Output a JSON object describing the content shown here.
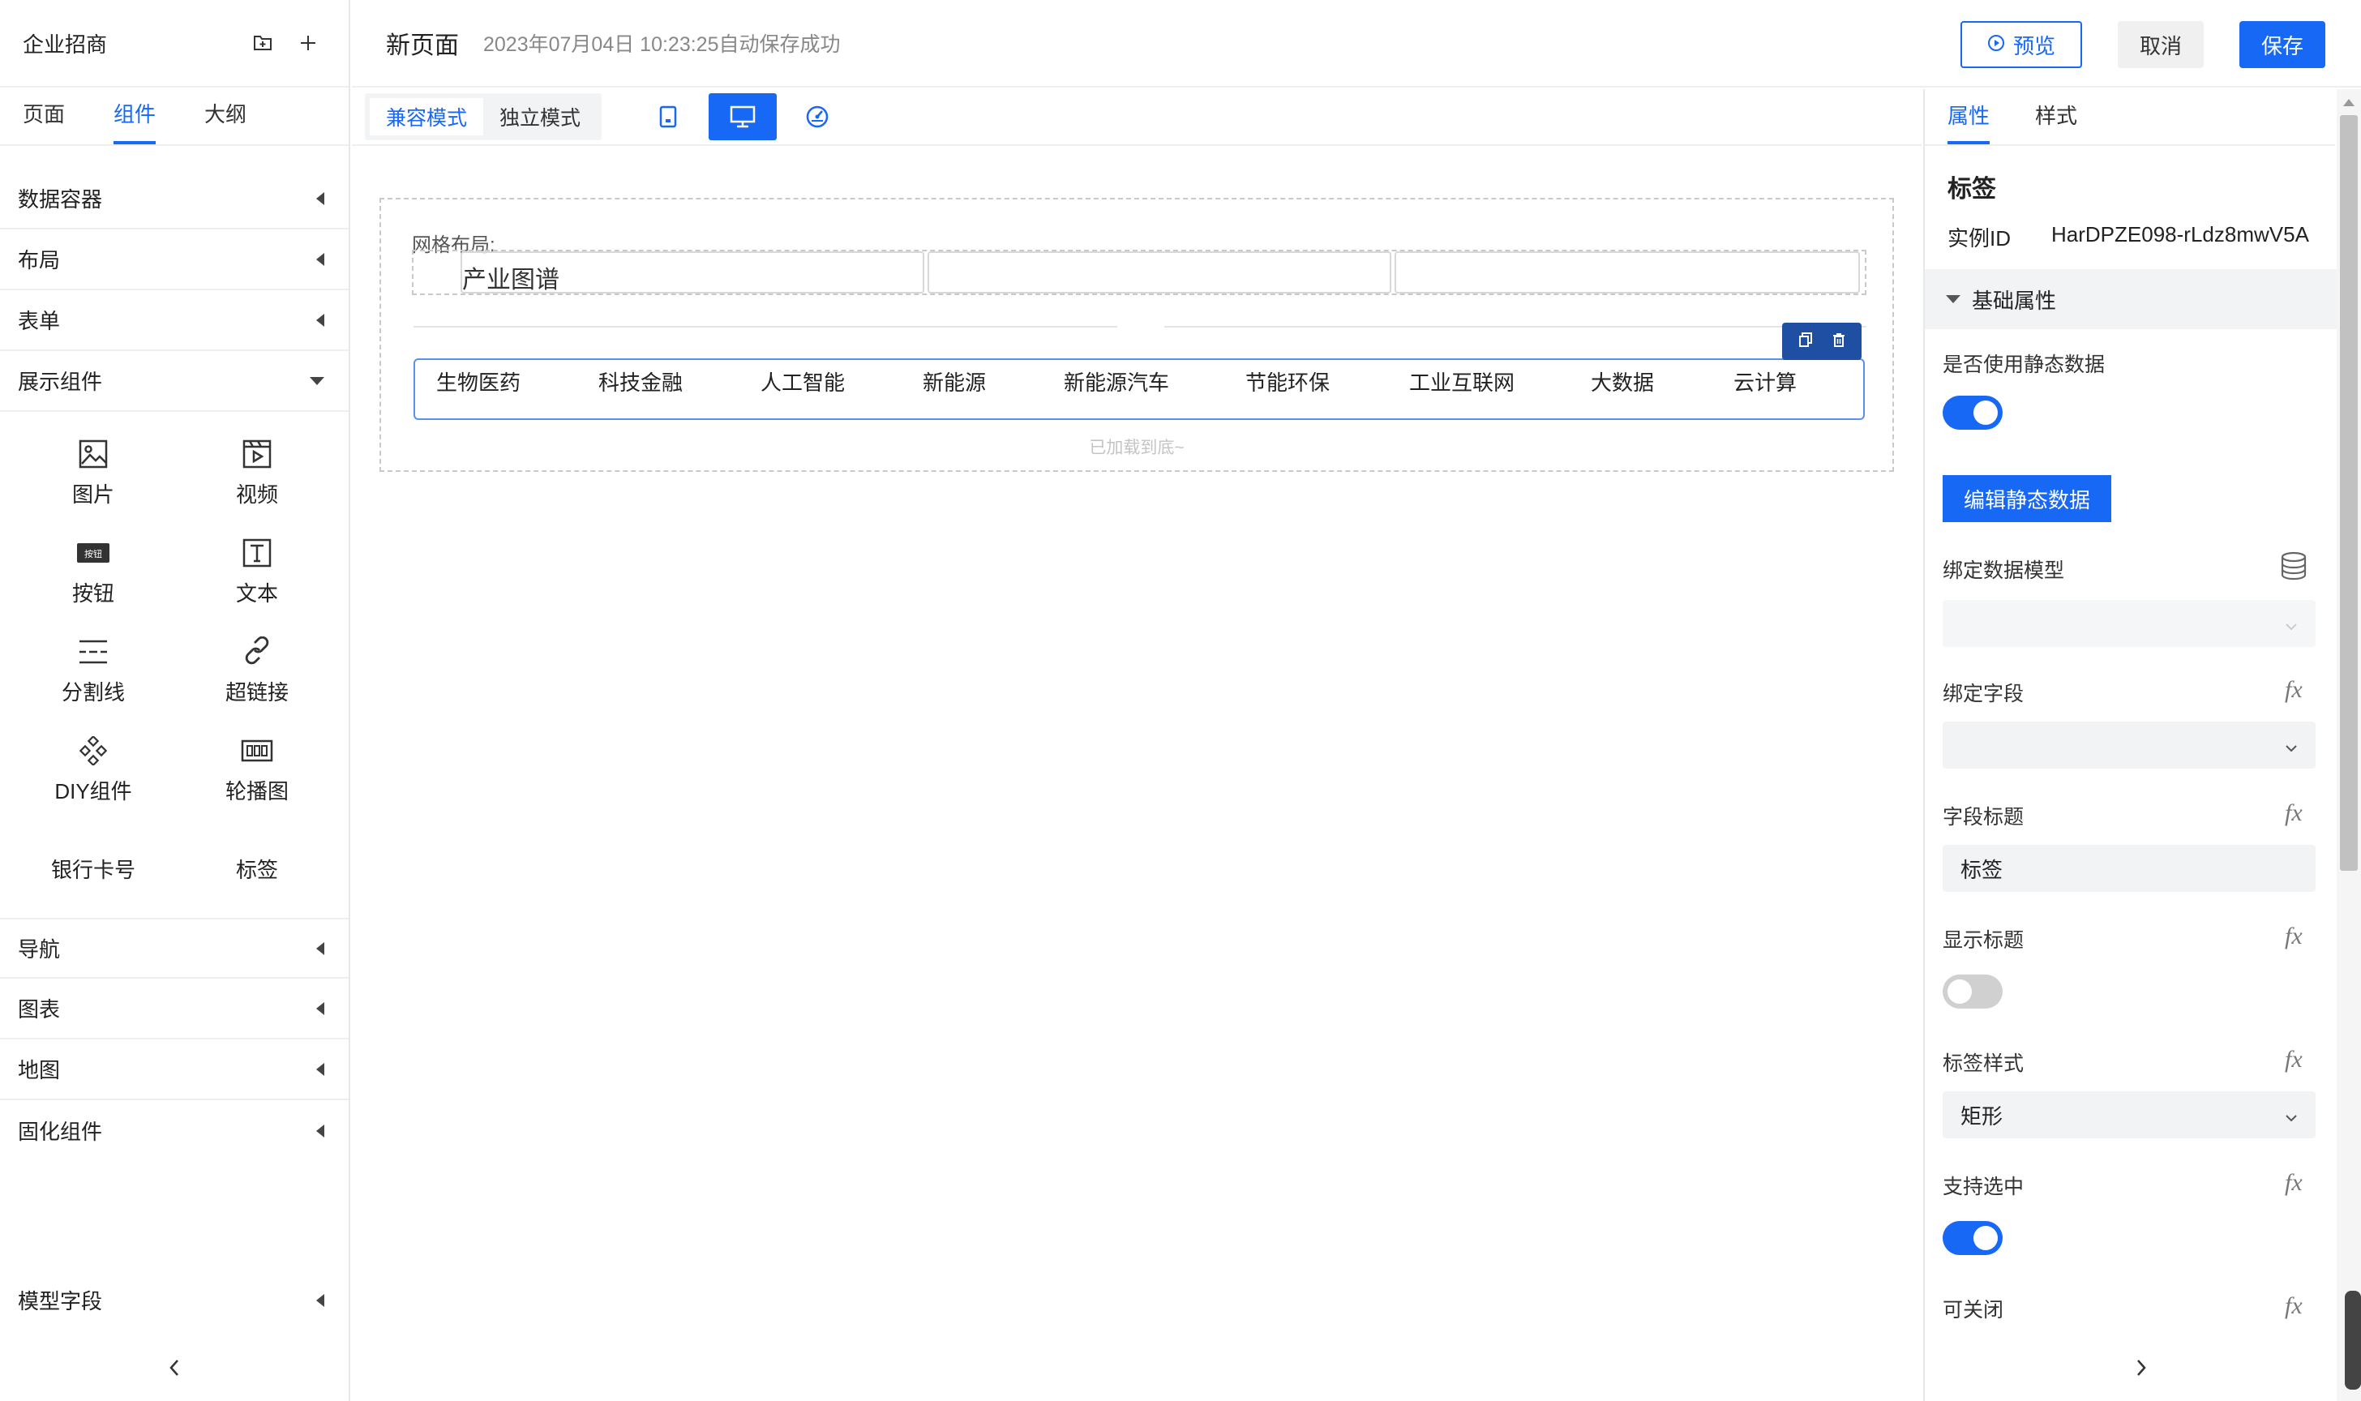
{
  "app": {
    "title": "企业招商"
  },
  "left": {
    "tabs": [
      "页面",
      "组件",
      "大纲"
    ],
    "categories_top": [
      "数据容器",
      "布局",
      "表单"
    ],
    "expanded_category": "展示组件",
    "components": [
      {
        "label": "图片",
        "icon": "image-icon"
      },
      {
        "label": "视频",
        "icon": "video-icon"
      },
      {
        "label": "按钮",
        "icon": "button-icon"
      },
      {
        "label": "文本",
        "icon": "text-icon"
      },
      {
        "label": "分割线",
        "icon": "divider-icon"
      },
      {
        "label": "超链接",
        "icon": "link-icon"
      },
      {
        "label": "DIY组件",
        "icon": "diy-icon"
      },
      {
        "label": "轮播图",
        "icon": "carousel-icon"
      }
    ],
    "button_icon_text": "按钮",
    "text_components": [
      "银行卡号",
      "标签"
    ],
    "categories_bottom": [
      "导航",
      "图表",
      "地图",
      "固化组件"
    ],
    "model_fields": "模型字段"
  },
  "topbar": {
    "page_name": "新页面",
    "save_status": "2023年07月04日 10:23:25自动保存成功",
    "preview": "预览",
    "cancel": "取消",
    "save": "保存"
  },
  "toolbar": {
    "modes": [
      "兼容模式",
      "独立模式"
    ]
  },
  "canvas": {
    "grid_label": "网格布局:",
    "cell1_text": "产业图谱",
    "tags": [
      "生物医药",
      "科技金融",
      "人工智能",
      "新能源",
      "新能源汽车",
      "节能环保",
      "工业互联网",
      "大数据",
      "云计算"
    ],
    "loaded_text": "已加载到底~"
  },
  "right": {
    "tabs": [
      "属性",
      "样式"
    ],
    "component_title": "标签",
    "instance_label": "实例ID",
    "instance_id": "HarDPZE098-rLdz8mwV5A",
    "section": "基础属性",
    "use_static": "是否使用静态数据",
    "edit_static": "编辑静态数据",
    "bind_model": "绑定数据模型",
    "bind_field": "绑定字段",
    "field_title": "字段标题",
    "field_title_value": "标签",
    "show_title": "显示标题",
    "tag_style": "标签样式",
    "tag_style_value": "矩形",
    "selectable": "支持选中",
    "closable": "可关闭",
    "fx": "fx"
  },
  "colors": {
    "accent": "#1668f5",
    "toolbar_dark": "#1f4fa3"
  }
}
